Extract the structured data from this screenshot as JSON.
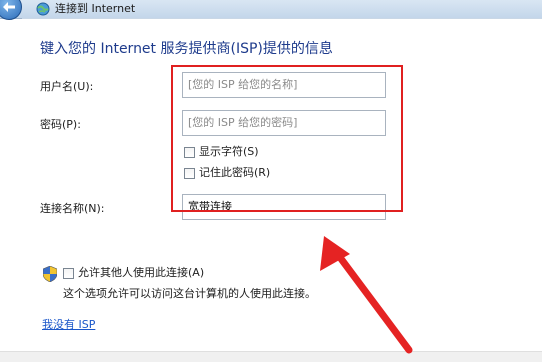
{
  "window": {
    "title": "连接到 Internet"
  },
  "heading": "键入您的 Internet 服务提供商(ISP)提供的信息",
  "form": {
    "username_label": "用户名(U):",
    "username_placeholder": "[您的 ISP 给您的名称]",
    "password_label": "密码(P):",
    "password_placeholder": "[您的 ISP 给您的密码]",
    "show_chars_label": "显示字符(S)",
    "remember_password_label": "记住此密码(R)",
    "connection_name_label": "连接名称(N):",
    "connection_name_value": "宽带连接"
  },
  "sharing": {
    "allow_others_label": "允许其他人使用此连接(A)",
    "description": "这个选项允许可以访问这台计算机的人使用此连接。"
  },
  "no_isp_link": "我没有 ISP",
  "colors": {
    "highlight_frame": "#e02020",
    "heading_text": "#1e3b8c",
    "link_text": "#1a56c9"
  },
  "icons": {
    "back": "back-arrow-icon",
    "network": "network-globe-icon",
    "shield": "uac-shield-icon"
  }
}
